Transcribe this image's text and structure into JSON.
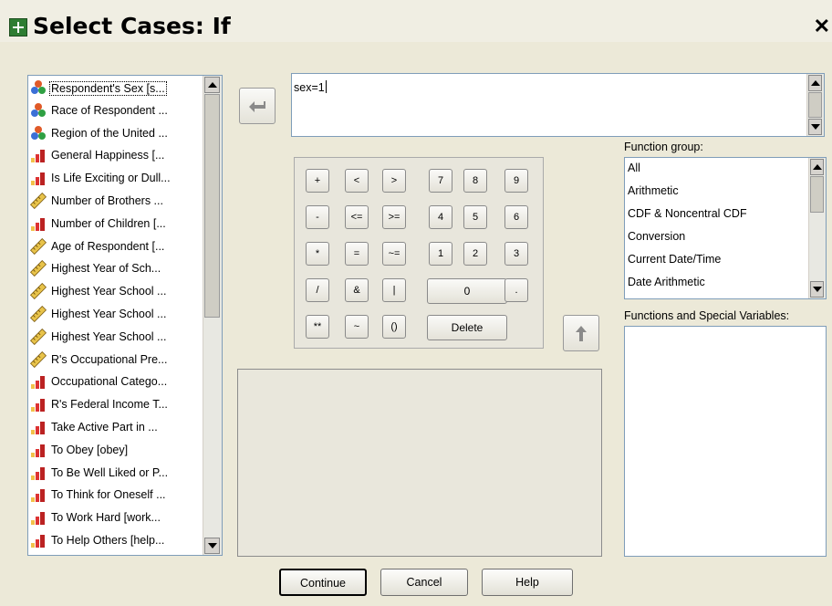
{
  "window": {
    "title": "Select Cases: If",
    "close_glyph": "✕"
  },
  "variables": [
    {
      "label": "Respondent's Sex [s...",
      "icon": "nominal-icon",
      "selected": true
    },
    {
      "label": "Race of Respondent ...",
      "icon": "nominal-icon"
    },
    {
      "label": "Region of the United ...",
      "icon": "nominal-icon"
    },
    {
      "label": "General Happiness [...",
      "icon": "ordinal-icon"
    },
    {
      "label": "Is Life Exciting or Dull...",
      "icon": "ordinal-icon"
    },
    {
      "label": "Number of Brothers ...",
      "icon": "scale-icon"
    },
    {
      "label": "Number of Children [...",
      "icon": "ordinal-icon"
    },
    {
      "label": "Age of Respondent [...",
      "icon": "scale-icon"
    },
    {
      "label": "Highest Year of Sch...",
      "icon": "scale-icon"
    },
    {
      "label": "Highest Year School ...",
      "icon": "scale-icon"
    },
    {
      "label": "Highest Year School ...",
      "icon": "scale-icon"
    },
    {
      "label": "Highest Year School ...",
      "icon": "scale-icon"
    },
    {
      "label": "R's Occupational Pre...",
      "icon": "scale-icon"
    },
    {
      "label": "Occupational Catego...",
      "icon": "ordinal-icon"
    },
    {
      "label": "R's Federal Income T...",
      "icon": "ordinal-icon"
    },
    {
      "label": "Take Active Part in ...",
      "icon": "ordinal-icon"
    },
    {
      "label": "To Obey [obey]",
      "icon": "ordinal-icon"
    },
    {
      "label": "To Be Well Liked or P...",
      "icon": "ordinal-icon"
    },
    {
      "label": "To Think for Oneself ...",
      "icon": "ordinal-icon"
    },
    {
      "label": "To Work Hard [work...",
      "icon": "ordinal-icon"
    },
    {
      "label": "To Help Others [help...",
      "icon": "ordinal-icon"
    }
  ],
  "expression": {
    "value": "sex=1"
  },
  "keypad": [
    [
      "+",
      "<",
      ">",
      "7",
      "8",
      "9"
    ],
    [
      "-",
      "<=",
      ">=",
      "4",
      "5",
      "6"
    ],
    [
      "*",
      "=",
      "~=",
      "1",
      "2",
      "3"
    ],
    [
      "/",
      "&",
      "|",
      "0",
      "."
    ],
    [
      "**",
      "~",
      "()",
      "Delete"
    ]
  ],
  "function_group": {
    "label": "Function group:",
    "items": [
      "All",
      "Arithmetic",
      "CDF & Noncentral CDF",
      "Conversion",
      "Current Date/Time",
      "Date Arithmetic"
    ]
  },
  "functions_label": "Functions and Special Variables:",
  "buttons": {
    "continue": "Continue",
    "cancel": "Cancel",
    "help": "Help"
  }
}
